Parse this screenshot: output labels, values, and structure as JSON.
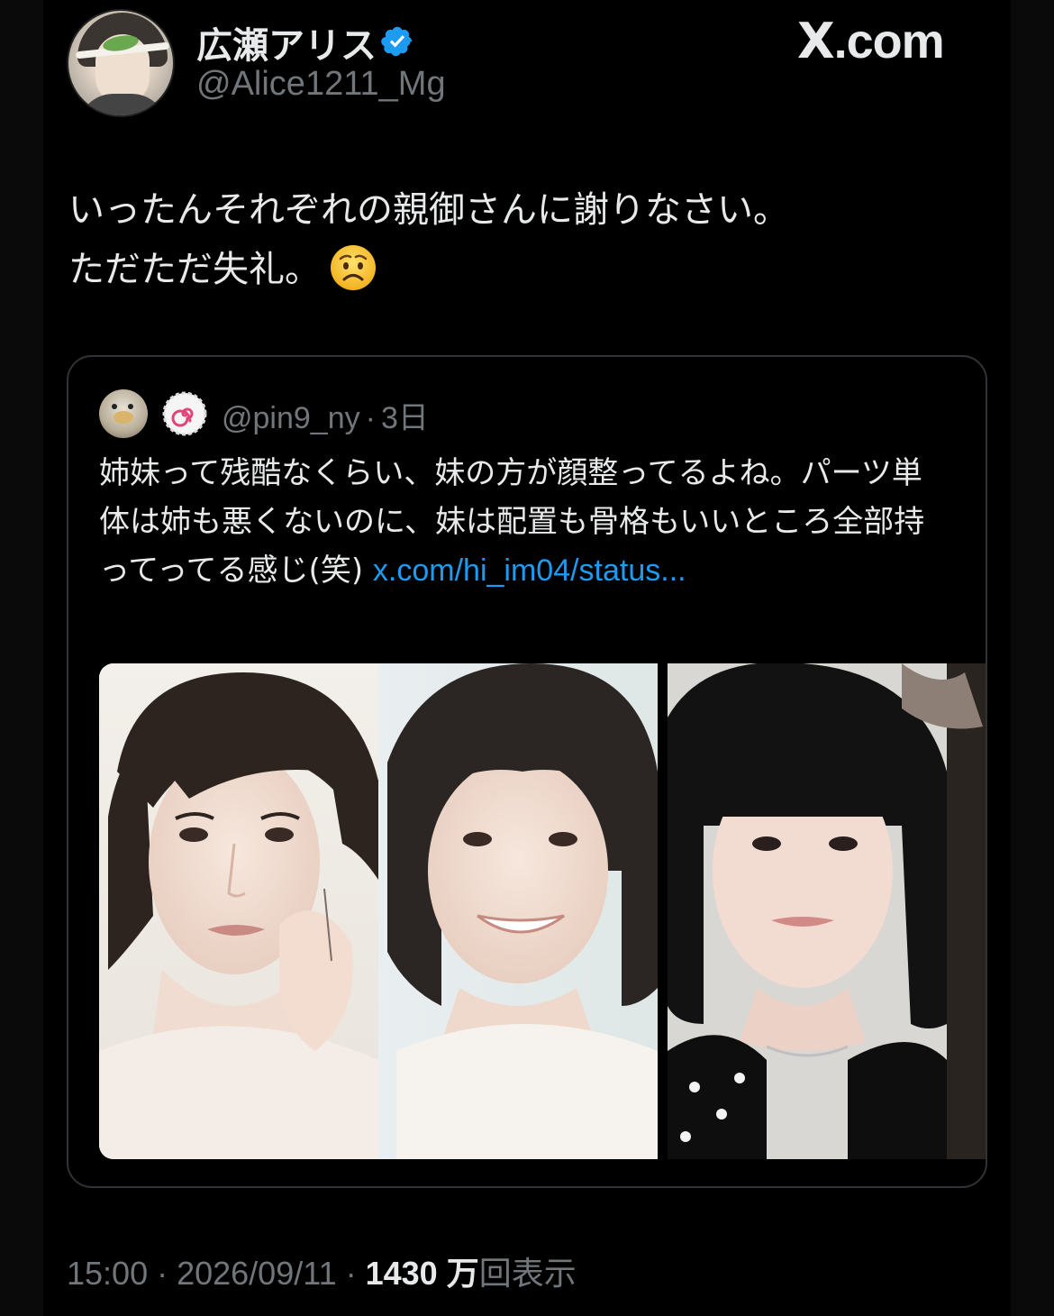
{
  "author": {
    "display_name": "広瀬アリス",
    "handle": "@Alice1211_Mg",
    "verified": true,
    "avatar_icon": "profile-photo"
  },
  "brand": {
    "label": "X.com",
    "x": "X",
    "rest": ".com"
  },
  "tweet": {
    "line1": "いったんそれぞれの親御さんに謝りなさい。",
    "line2": "ただただ失礼。",
    "emoji": "worried-face-emoji"
  },
  "quote": {
    "handle": "@pin9_ny",
    "separator": "·",
    "time": "3日",
    "text": "姉妹って残酷なくらい、妹の方が顔整ってるよね。パーツ単体は姉も悪くないのに、妹は配置も骨格もいいところ全部持ってってる感じ(笑) ",
    "link": "x.com/hi_im04/status...",
    "media_count": 2
  },
  "footer": {
    "time": "15:00",
    "separator": "·",
    "date": "2026/09/11",
    "views_number": "1430",
    "views_unit": "万",
    "views_label": "回表示"
  },
  "colors": {
    "background": "#000000",
    "text": "#e7e9ea",
    "muted": "#71767b",
    "link": "#1d9bf0",
    "verified": "#1d9bf0",
    "border": "#2f3336"
  }
}
